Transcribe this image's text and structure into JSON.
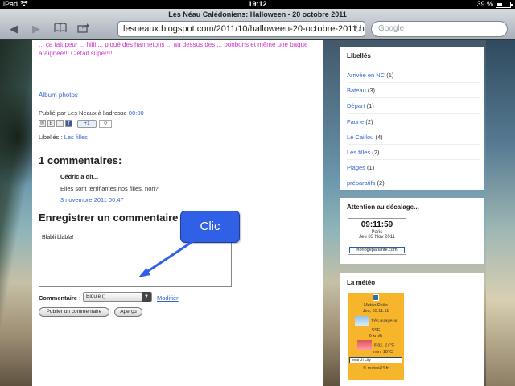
{
  "status_bar": {
    "carrier": "iPad",
    "time": "19:12",
    "battery": "39 %"
  },
  "browser": {
    "page_title": "Les Néau Calédoniens: Halloween - 20 octobre 2011",
    "url": "lesneaux.blogspot.com/2011/10/halloween-20-octobre-2011.html#...",
    "search_placeholder": "Google",
    "icons": [
      "back-icon",
      "forward-icon",
      "bookmarks-icon",
      "share-icon",
      "reload-icon"
    ]
  },
  "post": {
    "intro_text": "... ça fait peur ... hiiii ... piqué des hannetons ... au dessus des ... bonbons et même une baque araignée!!! C'était super!!!",
    "album_link": "Album photos",
    "published_prefix": "Publié par Les Neaux à l'adresse ",
    "published_time": "00:00",
    "plusone_label": "+1",
    "plusone_count": "0",
    "labels_prefix": "Libellés : ",
    "labels_value": "Les filles"
  },
  "comments": {
    "heading": "1 commentaires:",
    "author": "Cédric a dit...",
    "text": "Elles sont terrifiantes nos filles, non?",
    "date": "3 novembre 2011 00:47"
  },
  "comment_form": {
    "heading": "Enregistrer un commentaire",
    "textarea_value": "Blabli blabla!",
    "comment_as_label": "Commentaire :",
    "identity_value": "Bidule ()",
    "modify_link": "Modifier",
    "publish_button": "Publier un commentaire",
    "preview_button": "Aperçu"
  },
  "callout": {
    "text": "Clic",
    "color": "#3060e6"
  },
  "sidebar": {
    "labels_title": "Libellés",
    "labels": [
      {
        "name": "Arrivée en NC",
        "count": "(1)"
      },
      {
        "name": "Bateau",
        "count": "(3)"
      },
      {
        "name": "Départ",
        "count": "(1)"
      },
      {
        "name": "Faune",
        "count": "(2)"
      },
      {
        "name": "Le Caillou",
        "count": "(4)"
      },
      {
        "name": "Les filles",
        "count": "(2)"
      },
      {
        "name": "Plages",
        "count": "(1)"
      },
      {
        "name": "préparatifs",
        "count": "(2)"
      }
    ],
    "clock_title": "Attention au décalage...",
    "clock": {
      "time": "09:11:59",
      "city": "Paris",
      "date": "Jeu 03 Nov 2011",
      "brand": "horlogeparlante.com"
    },
    "meteo_title": "La météo",
    "meteo": {
      "station": "Météo Païta",
      "date": "Jeu, 03.11.11",
      "condition": "très nuageux",
      "wind_dir": "SSE",
      "wind_speed": "6 km/h",
      "max": "max.    27°C",
      "min": "min.    18°C",
      "search": "search city",
      "brand": "© meteo24.fr"
    }
  }
}
